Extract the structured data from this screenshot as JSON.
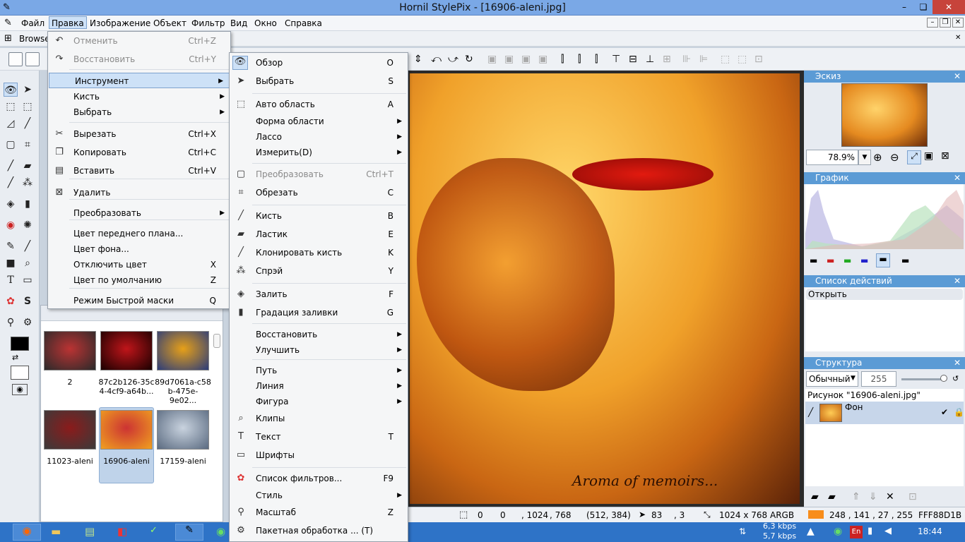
{
  "app": {
    "title": "Hornil StylePix - [16906-aleni.jpg]",
    "min": "–",
    "max": "❏",
    "close": "✕"
  },
  "menubar": [
    "Файл",
    "Правка",
    "Изображение",
    "Объект",
    "Фильтр",
    "Вид",
    "Окно",
    "Справка"
  ],
  "browse_tab": "Browse",
  "edit_menu": [
    {
      "label": "Отменить",
      "shortcut": "Ctrl+Z",
      "disabled": true,
      "icon": "undo-icon"
    },
    {
      "label": "Восстановить",
      "shortcut": "Ctrl+Y",
      "disabled": true,
      "icon": "redo-icon"
    },
    {
      "label": "Инструмент",
      "sub": true,
      "highlight": true
    },
    {
      "label": "Кисть",
      "sub": true
    },
    {
      "label": "Выбрать",
      "sub": true
    },
    {
      "label": "Вырезать",
      "shortcut": "Ctrl+X",
      "icon": "scissors-icon"
    },
    {
      "label": "Копировать",
      "shortcut": "Ctrl+C",
      "icon": "copy-icon"
    },
    {
      "label": "Вставить",
      "shortcut": "Ctrl+V",
      "icon": "paste-icon"
    },
    {
      "label": "Удалить",
      "icon": "delete-icon"
    },
    {
      "label": "Преобразовать",
      "sub": true
    },
    {
      "label": "Цвет переднего  плана..."
    },
    {
      "label": "Цвет фона..."
    },
    {
      "label": "Отключить цвет",
      "shortcut": "X"
    },
    {
      "label": "Цвет по умолчанию",
      "shortcut": "Z"
    },
    {
      "label": "Режим Быстрой маски",
      "shortcut": "Q"
    }
  ],
  "tool_menu": [
    {
      "label": "Обзор",
      "shortcut": "O",
      "icon": "eye-icon"
    },
    {
      "label": "Выбрать",
      "shortcut": "S",
      "icon": "arrow-icon"
    },
    {
      "label": "Авто область",
      "shortcut": "A",
      "icon": "auto-select-icon"
    },
    {
      "label": "Форма области",
      "sub": true
    },
    {
      "label": "Лассо",
      "sub": true
    },
    {
      "label": "Измерить(D)",
      "sub": true
    },
    {
      "label": "Преобразовать",
      "shortcut": "Ctrl+T",
      "disabled": true,
      "icon": "transform-icon"
    },
    {
      "label": "Обрезать",
      "shortcut": "C",
      "icon": "crop-icon"
    },
    {
      "label": "Кисть",
      "shortcut": "B",
      "icon": "brush-icon"
    },
    {
      "label": "Ластик",
      "shortcut": "E",
      "icon": "eraser-icon"
    },
    {
      "label": "Клонировать кисть",
      "shortcut": "K",
      "icon": "clone-icon"
    },
    {
      "label": "Спрэй",
      "shortcut": "Y",
      "icon": "spray-icon"
    },
    {
      "label": "Залить",
      "shortcut": "F",
      "icon": "fill-icon"
    },
    {
      "label": "Градация заливки",
      "shortcut": "G",
      "icon": "gradient-icon"
    },
    {
      "label": "Восстановить",
      "sub": true
    },
    {
      "label": "Улучшить",
      "sub": true
    },
    {
      "label": "Путь",
      "sub": true
    },
    {
      "label": "Линия",
      "sub": true
    },
    {
      "label": "Фигура",
      "sub": true
    },
    {
      "label": "Клипы",
      "icon": "clip-icon"
    },
    {
      "label": "Текст",
      "shortcut": "T",
      "icon": "text-icon"
    },
    {
      "label": "Шрифты",
      "icon": "folder-icon"
    },
    {
      "label": "Список фильтров...",
      "shortcut": "F9",
      "icon": "color-wheel-icon"
    },
    {
      "label": "Стиль",
      "sub": true
    },
    {
      "label": "Масштаб",
      "shortcut": "Z",
      "icon": "zoom-icon"
    },
    {
      "label": "Пакетная обработка ... (T)",
      "icon": "gear-icon"
    }
  ],
  "browser": {
    "items": [
      {
        "caption": "2",
        "c1": "#2a2a2a",
        "c2": "#b33"
      },
      {
        "caption": "87c2b126-35c\n4-4cf9-a64b...",
        "c1": "#1a0000",
        "c2": "#c0151a"
      },
      {
        "caption": "89d7061a-c58\nb-475e-9e02...",
        "c1": "#2b3c7a",
        "c2": "#e7a018"
      },
      {
        "caption": "11023-aleni",
        "c1": "#3a3a3a",
        "c2": "#8b1b1b"
      },
      {
        "caption": "16906-aleni",
        "c1": "#f0a020",
        "c2": "#c33",
        "selected": true
      },
      {
        "caption": "17159-aleni",
        "c1": "#5a6a80",
        "c2": "#c9d3df"
      }
    ]
  },
  "statusbar": {
    "sel_x": "0",
    "sel_y": "0",
    "sel_w": ", 1024",
    "sel_h": ", 768",
    "center": "(512, 384)",
    "cursor_x": "83",
    "cursor_y": ", 3",
    "size": "1024 x 768 ARGB"
  },
  "panels": {
    "eskiz": "Эскиз",
    "zoom": "78.9%",
    "graph": "График",
    "actions": "Список действий",
    "action_item": "Открыть",
    "structure": "Структура",
    "blend": "Обычный",
    "opacity": "255",
    "doc": "Рисунок \"16906-aleni.jpg\"",
    "layer": "Фон",
    "color_values": "248 , 141 , 27  , 255",
    "color_hex": "FFF88D1B",
    "color_swatch": "#f88d1b"
  },
  "taskbar": {
    "net1": "6,3 kbps",
    "net2": "5,7 kbps",
    "lang": "En",
    "time": "18:44"
  }
}
